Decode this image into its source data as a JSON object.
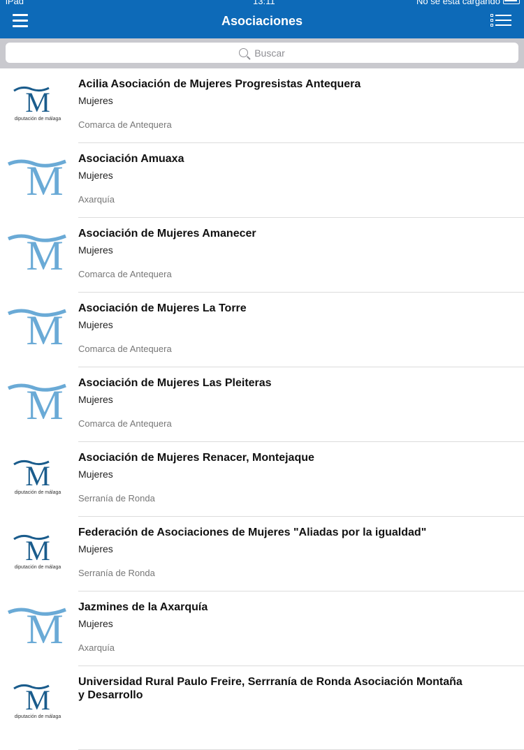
{
  "status_bar": {
    "device": "iPad",
    "time": "13:11",
    "battery_text": "No se está cargando"
  },
  "nav": {
    "title": "Asociaciones"
  },
  "search": {
    "placeholder": "Buscar"
  },
  "logos": {
    "small_brand": "diputación de málaga",
    "letter": "M"
  },
  "colors": {
    "nav_bg": "#0d6ab8",
    "logo_dark": "#1a5c8c",
    "logo_light": "#6aaad6"
  },
  "items": [
    {
      "title": "Acilia Asociación de Mujeres Progresistas Antequera",
      "category": "Mujeres",
      "region": "Comarca de Antequera",
      "logo": "dark"
    },
    {
      "title": "Asociación Amuaxa",
      "category": "Mujeres",
      "region": "Axarquía",
      "logo": "light"
    },
    {
      "title": "Asociación de Mujeres Amanecer",
      "category": "Mujeres",
      "region": "Comarca de Antequera",
      "logo": "light"
    },
    {
      "title": "Asociación de Mujeres La Torre",
      "category": "Mujeres",
      "region": "Comarca de Antequera",
      "logo": "light"
    },
    {
      "title": "Asociación de Mujeres Las Pleiteras",
      "category": "Mujeres",
      "region": "Comarca de Antequera",
      "logo": "light"
    },
    {
      "title": "Asociación de Mujeres Renacer, Montejaque",
      "category": "Mujeres",
      "region": "Serranía de Ronda",
      "logo": "dark"
    },
    {
      "title": "Federación de Asociaciones de Mujeres \"Aliadas por la igualdad\"",
      "category": "Mujeres",
      "region": "Serranía de Ronda",
      "logo": "dark"
    },
    {
      "title": "Jazmines de la Axarquía",
      "category": "Mujeres",
      "region": "Axarquía",
      "logo": "light"
    },
    {
      "title": "Universidad Rural Paulo Freire, Serrranía de Ronda Asociación Montaña y Desarrollo",
      "category": "",
      "region": "",
      "logo": "dark"
    }
  ]
}
